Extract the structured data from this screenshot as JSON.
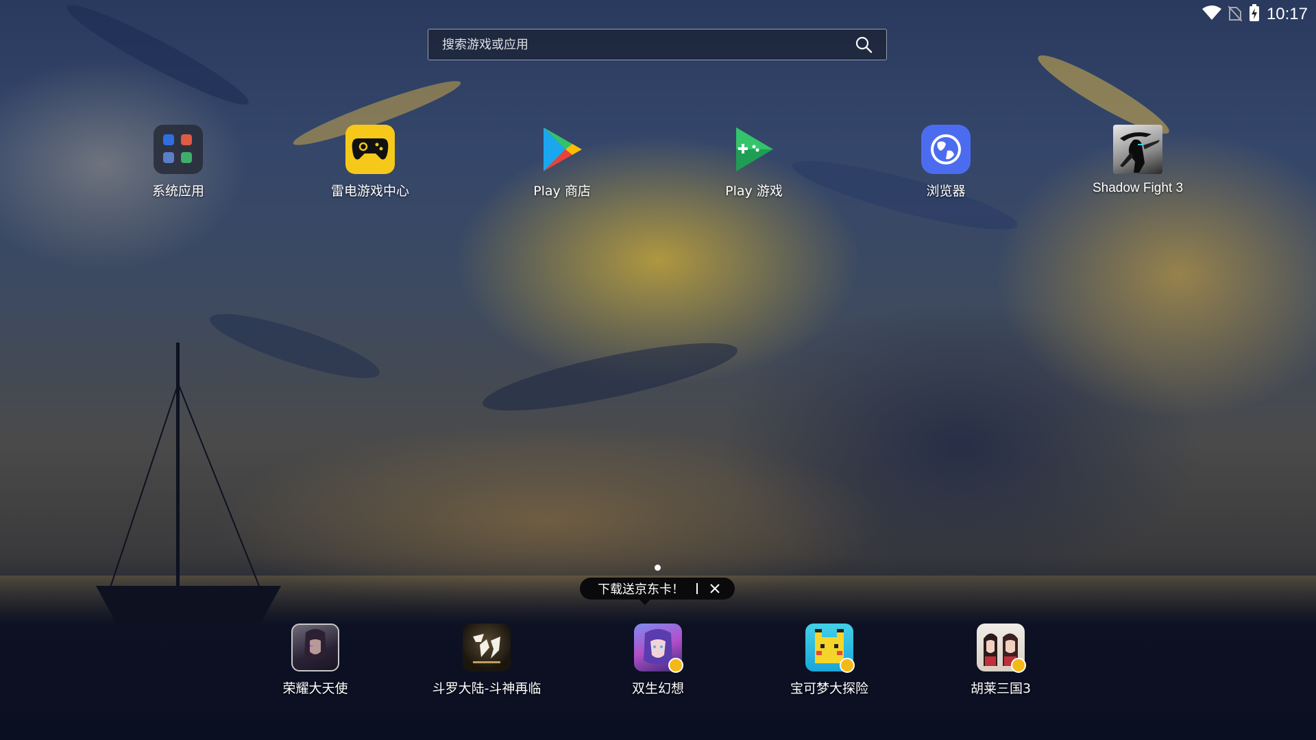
{
  "status_bar": {
    "time": "10:17",
    "icons": [
      "wifi-icon",
      "no-sim-icon",
      "battery-charging-icon"
    ]
  },
  "search": {
    "placeholder": "搜索游戏或应用",
    "icon": "search-icon"
  },
  "apps": [
    {
      "label": "系统应用",
      "icon": "folder-icon"
    },
    {
      "label": "雷电游戏中心",
      "icon": "gamepad-icon"
    },
    {
      "label": "Play 商店",
      "icon": "play-store-icon"
    },
    {
      "label": "Play 游戏",
      "icon": "play-games-icon"
    },
    {
      "label": "浏览器",
      "icon": "browser-icon"
    },
    {
      "label": "Shadow Fight 3",
      "icon": "shadow-fight-icon"
    }
  ],
  "tooltip": {
    "text": "下载送京东卡！",
    "close_icon": "close-icon"
  },
  "dock": [
    {
      "label": "荣耀大天使",
      "icon": "game-icon"
    },
    {
      "label": "斗罗大陆-斗神再临",
      "icon": "game-icon"
    },
    {
      "label": "双生幻想",
      "icon": "game-icon"
    },
    {
      "label": "宝可梦大探险",
      "icon": "game-icon"
    },
    {
      "label": "胡莱三国3",
      "icon": "game-icon"
    }
  ],
  "pager": {
    "pages": 1,
    "current": 1
  }
}
